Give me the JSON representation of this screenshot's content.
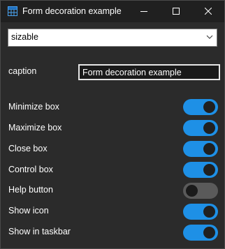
{
  "window": {
    "title": "Form decoration example",
    "accent_color": "#1e90e6",
    "icons": {
      "app": "window-grid-icon",
      "minimize": "minimize-icon",
      "maximize": "maximize-icon",
      "close": "close-icon"
    }
  },
  "combo": {
    "selected": "sizable",
    "arrow_icon": "chevron-down-icon"
  },
  "caption": {
    "label": "caption",
    "value": "Form decoration example"
  },
  "toggles": [
    {
      "label": "Minimize box",
      "on": true
    },
    {
      "label": "Maximize box",
      "on": true
    },
    {
      "label": "Close box",
      "on": true
    },
    {
      "label": "Control box",
      "on": true
    },
    {
      "label": "Help button",
      "on": false
    },
    {
      "label": "Show icon",
      "on": true
    },
    {
      "label": "Show in taskbar",
      "on": true
    }
  ]
}
